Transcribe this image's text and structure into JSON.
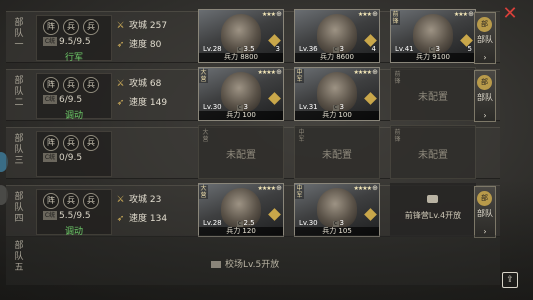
{
  "units": [
    {
      "label": "部队一",
      "badges": [
        "阵",
        "兵",
        "兵"
      ],
      "cost_icon": "C统",
      "cost": "9.5/9.5",
      "status": "行军",
      "stats": [
        {
          "icon": "swords-icon",
          "name": "攻城",
          "value": "257"
        },
        {
          "icon": "speed-icon",
          "name": "速度",
          "value": "80"
        }
      ],
      "slots": [
        {
          "type": "hero",
          "role": "",
          "stars": "★★★",
          "level": "Lv.28",
          "cost": "3.5",
          "num": "3",
          "troops": "兵力 8800"
        },
        {
          "type": "hero",
          "role": "",
          "stars": "★★★",
          "level": "Lv.36",
          "cost": "3",
          "num": "4",
          "troops": "兵力 8600"
        },
        {
          "type": "hero",
          "role": "前锋",
          "stars": "★★★",
          "level": "Lv.41",
          "cost": "3",
          "num": "5",
          "troops": "兵力 9100"
        }
      ]
    },
    {
      "label": "部队二",
      "badges": [
        "阵",
        "兵",
        "兵"
      ],
      "cost_icon": "C统",
      "cost": "6/9.5",
      "status": "调动",
      "stats": [
        {
          "icon": "swords-icon",
          "name": "攻城",
          "value": "68"
        },
        {
          "icon": "speed-icon",
          "name": "速度",
          "value": "149"
        }
      ],
      "slots": [
        {
          "type": "hero",
          "role": "大营",
          "stars": "★★★★",
          "level": "Lv.30",
          "cost": "3",
          "num": "",
          "troops": "兵力 100"
        },
        {
          "type": "hero",
          "role": "中军",
          "stars": "★★★★",
          "level": "Lv.31",
          "cost": "3",
          "num": "",
          "troops": "兵力 100"
        },
        {
          "type": "empty",
          "role": "前锋",
          "text": "未配置"
        }
      ]
    },
    {
      "label": "部队三",
      "badges": [
        "阵",
        "兵",
        "兵"
      ],
      "cost_icon": "C统",
      "cost": "0/9.5",
      "status": "",
      "stats": [],
      "slots": [
        {
          "type": "empty",
          "role": "大营",
          "text": "未配置"
        },
        {
          "type": "empty",
          "role": "中军",
          "text": "未配置"
        },
        {
          "type": "empty",
          "role": "前锋",
          "text": "未配置"
        }
      ]
    },
    {
      "label": "部队四",
      "badges": [
        "阵",
        "兵",
        "兵"
      ],
      "cost_icon": "C统",
      "cost": "5.5/9.5",
      "status": "调动",
      "stats": [
        {
          "icon": "swords-icon",
          "name": "攻城",
          "value": "23"
        },
        {
          "icon": "speed-icon",
          "name": "速度",
          "value": "134"
        }
      ],
      "slots": [
        {
          "type": "hero",
          "role": "大营",
          "stars": "★★★★",
          "level": "Lv.28",
          "cost": "2.5",
          "num": "",
          "troops": "兵力 120"
        },
        {
          "type": "hero",
          "role": "中军",
          "stars": "★★★★",
          "level": "Lv.30",
          "cost": "3",
          "num": "",
          "troops": "兵力 105"
        },
        {
          "type": "locked",
          "text": "前锋营Lv.4开放"
        }
      ]
    }
  ],
  "unit_button": {
    "text": "部队",
    "arrow": "›",
    "emblem": "部"
  },
  "last_unit": {
    "label": "部队五",
    "unlock_text": "校场Lv.5开放"
  },
  "close_label": "✕",
  "share_label": "⇪"
}
